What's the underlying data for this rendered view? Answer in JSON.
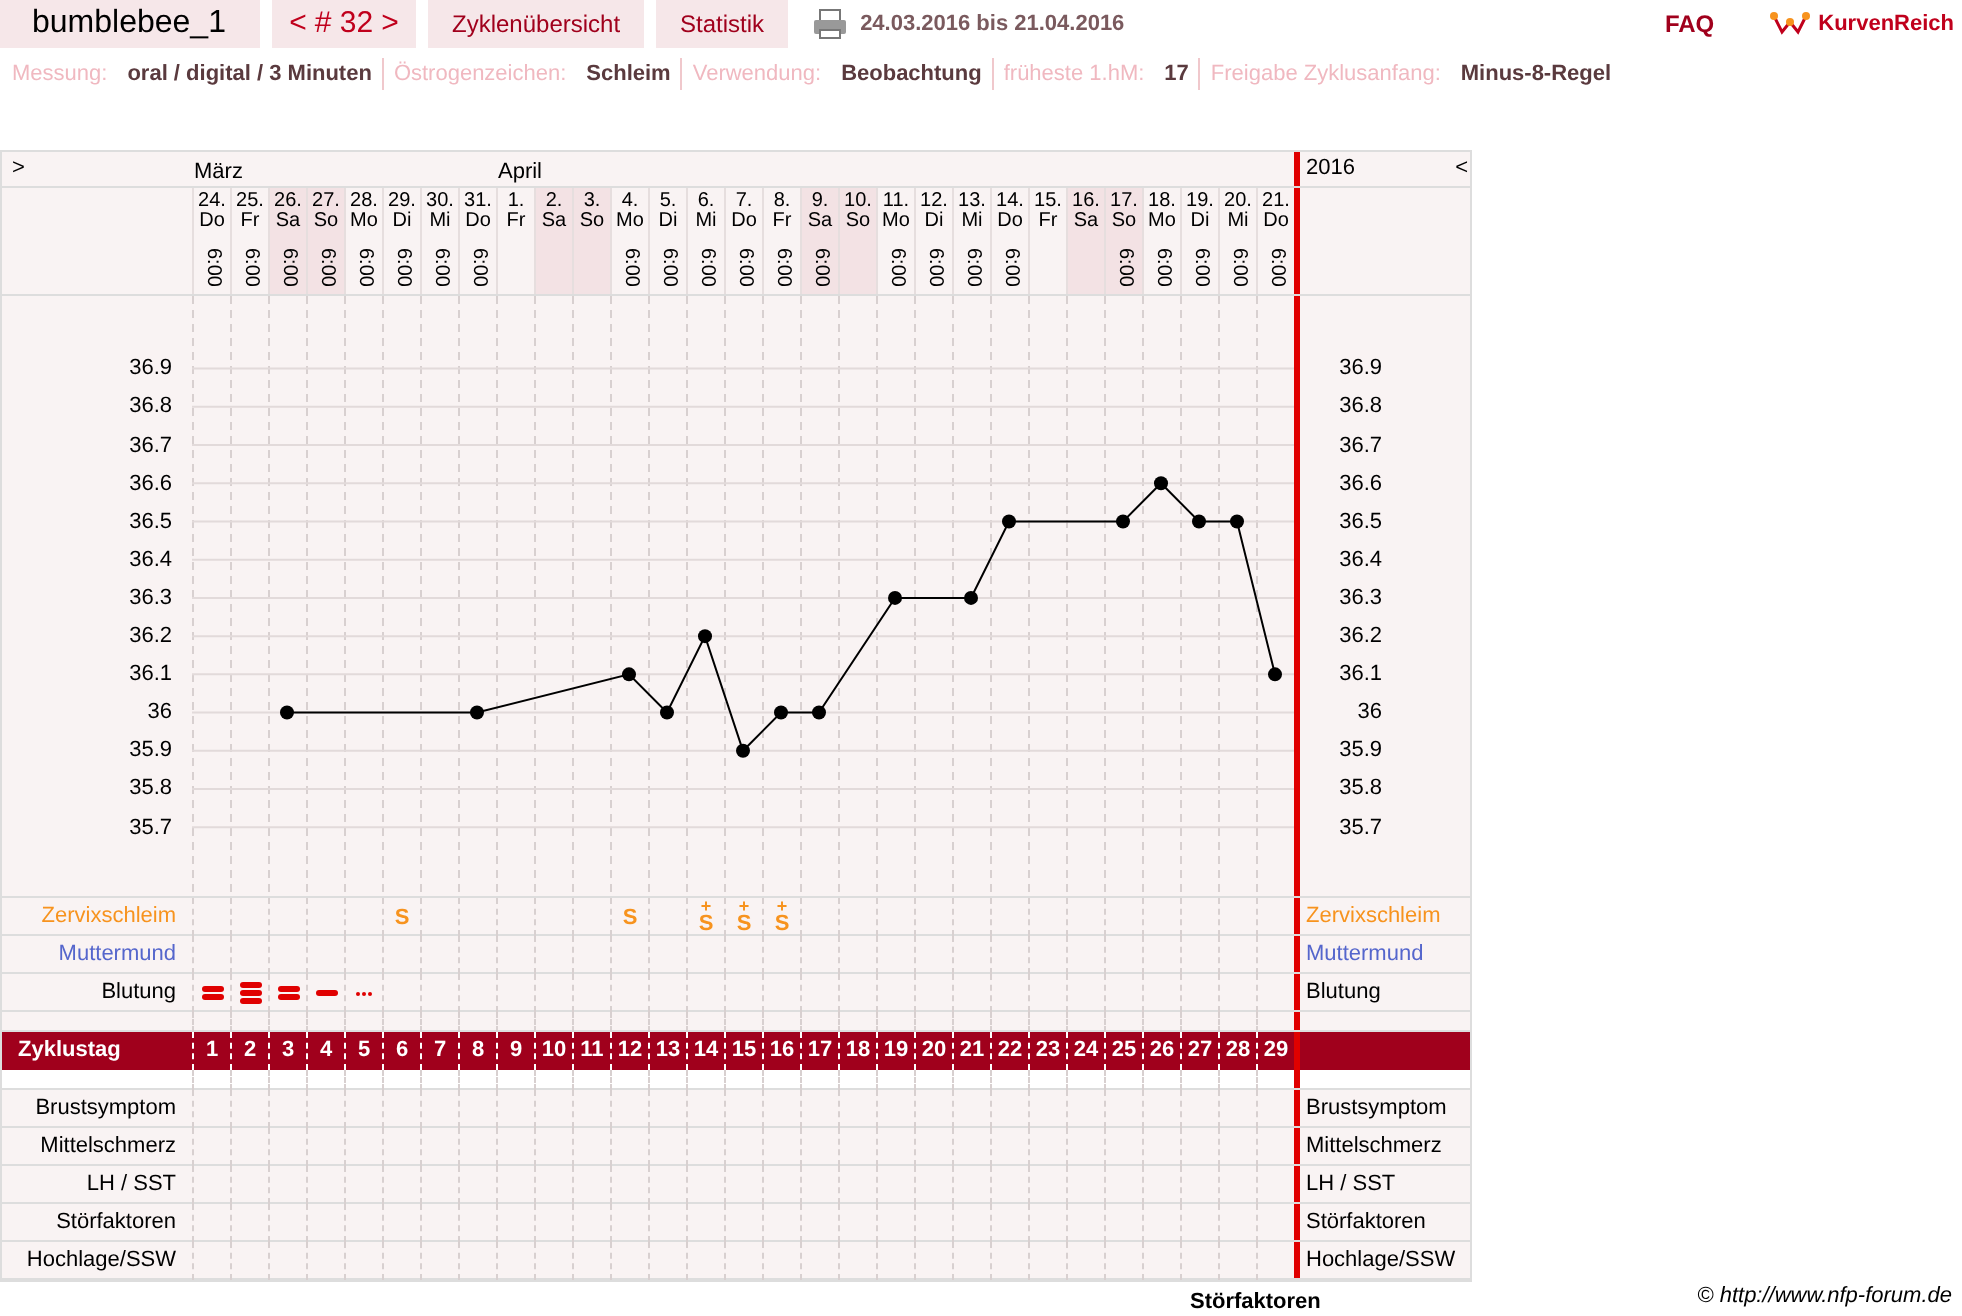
{
  "header": {
    "user": "bumblebee_1",
    "prev": "<",
    "cycle": "# 32",
    "next": ">",
    "tabs": [
      {
        "label": "Zyklenübersicht",
        "selected": false
      },
      {
        "label": "Statistik",
        "selected": false
      }
    ],
    "period": "24.03.2016 bis 21.04.2016",
    "faq": "FAQ",
    "logo": "KurvenReich"
  },
  "info": [
    {
      "label": "Messung:",
      "value": "oral / digital / 3 Minuten"
    },
    {
      "label": "Östrogenzeichen:",
      "value": "Schleim"
    },
    {
      "label": "Verwendung:",
      "value": "Beobachtung"
    },
    {
      "label": "früheste 1.hM:",
      "value": "17"
    },
    {
      "label": "Freigabe Zyklusanfang:",
      "value": "Minus-8-Regel"
    }
  ],
  "chart_header": {
    "left_toggle": ">",
    "year": "2016",
    "right_toggle": "<"
  },
  "days": [
    {
      "month": "März",
      "date": "24.",
      "weekday": "Do",
      "time": "6:00",
      "weekend": false,
      "cycle_day": "1",
      "bleeding": {
        "kind": "medium"
      }
    },
    {
      "date": "25.",
      "weekday": "Fr",
      "time": "6:00",
      "weekend": false,
      "cycle_day": "2",
      "bleeding": {
        "kind": "heavy"
      }
    },
    {
      "date": "26.",
      "weekday": "Sa",
      "time": "6:00",
      "weekend": true,
      "cycle_day": "3",
      "bleeding": {
        "kind": "medium"
      }
    },
    {
      "date": "27.",
      "weekday": "So",
      "time": "6:00",
      "weekend": true,
      "cycle_day": "4",
      "bleeding": {
        "kind": "light"
      }
    },
    {
      "date": "28.",
      "weekday": "Mo",
      "time": "6:00",
      "weekend": false,
      "cycle_day": "5",
      "bleeding": {
        "kind": "spotting"
      }
    },
    {
      "date": "29.",
      "weekday": "Di",
      "time": "6:00",
      "weekend": false,
      "cycle_day": "6",
      "mucus": "S"
    },
    {
      "date": "30.",
      "weekday": "Mi",
      "time": "6:00",
      "weekend": false,
      "cycle_day": "7"
    },
    {
      "date": "31.",
      "weekday": "Do",
      "time": "6:00",
      "weekend": false,
      "cycle_day": "8"
    },
    {
      "month": "April",
      "date": "1.",
      "weekday": "Fr",
      "weekend": false,
      "cycle_day": "9"
    },
    {
      "date": "2.",
      "weekday": "Sa",
      "weekend": true,
      "cycle_day": "10"
    },
    {
      "date": "3.",
      "weekday": "So",
      "weekend": true,
      "cycle_day": "11"
    },
    {
      "date": "4.",
      "weekday": "Mo",
      "time": "6:00",
      "weekend": false,
      "cycle_day": "12",
      "mucus": "S"
    },
    {
      "date": "5.",
      "weekday": "Di",
      "time": "6:00",
      "weekend": false,
      "cycle_day": "13"
    },
    {
      "date": "6.",
      "weekday": "Mi",
      "time": "6:00",
      "weekend": false,
      "cycle_day": "14",
      "mucus": "S",
      "mucus_mark": "+"
    },
    {
      "date": "7.",
      "weekday": "Do",
      "time": "6:00",
      "weekend": false,
      "cycle_day": "15",
      "mucus": "S",
      "mucus_mark": "+"
    },
    {
      "date": "8.",
      "weekday": "Fr",
      "time": "6:00",
      "weekend": false,
      "cycle_day": "16",
      "mucus": "S",
      "mucus_mark": "+"
    },
    {
      "date": "9.",
      "weekday": "Sa",
      "time": "6:00",
      "weekend": true,
      "cycle_day": "17"
    },
    {
      "date": "10.",
      "weekday": "So",
      "weekend": true,
      "cycle_day": "18"
    },
    {
      "date": "11.",
      "weekday": "Mo",
      "time": "6:00",
      "weekend": false,
      "cycle_day": "19"
    },
    {
      "date": "12.",
      "weekday": "Di",
      "time": "6:00",
      "weekend": false,
      "cycle_day": "20"
    },
    {
      "date": "13.",
      "weekday": "Mi",
      "time": "6:00",
      "weekend": false,
      "cycle_day": "21"
    },
    {
      "date": "14.",
      "weekday": "Do",
      "time": "6:00",
      "weekend": false,
      "cycle_day": "22"
    },
    {
      "date": "15.",
      "weekday": "Fr",
      "weekend": false,
      "cycle_day": "23"
    },
    {
      "date": "16.",
      "weekday": "Sa",
      "weekend": true,
      "cycle_day": "24"
    },
    {
      "date": "17.",
      "weekday": "So",
      "time": "6:00",
      "weekend": true,
      "cycle_day": "25"
    },
    {
      "date": "18.",
      "weekday": "Mo",
      "time": "6:00",
      "weekend": false,
      "cycle_day": "26"
    },
    {
      "date": "19.",
      "weekday": "Di",
      "time": "6:00",
      "weekend": false,
      "cycle_day": "27"
    },
    {
      "date": "20.",
      "weekday": "Mi",
      "time": "6:00",
      "weekend": false,
      "cycle_day": "28"
    },
    {
      "date": "21.",
      "weekday": "Do",
      "time": "6:00",
      "weekend": false,
      "cycle_day": "29"
    }
  ],
  "chart_data": {
    "type": "line",
    "grid": true,
    "ylim": [
      35.52,
      37.09
    ],
    "series": [
      {
        "color": "#000000",
        "marker": "circle",
        "values": [
          null,
          null,
          36.0,
          null,
          null,
          null,
          null,
          36.0,
          null,
          null,
          null,
          36.1,
          36.0,
          36.2,
          35.9,
          36.0,
          36.0,
          null,
          36.3,
          null,
          36.3,
          36.5,
          null,
          null,
          36.5,
          36.6,
          36.5,
          36.5,
          36.1
        ]
      }
    ],
    "yticks": [
      {
        "value": 35.7,
        "label": "35.7"
      },
      {
        "value": 35.8,
        "label": "35.8"
      },
      {
        "value": 35.9,
        "label": "35.9"
      },
      {
        "value": 36.0,
        "label": "36"
      },
      {
        "value": 36.1,
        "label": "36.1"
      },
      {
        "value": 36.2,
        "label": "36.2"
      },
      {
        "value": 36.3,
        "label": "36.3"
      },
      {
        "value": 36.4,
        "label": "36.4"
      },
      {
        "value": 36.5,
        "label": "36.5"
      },
      {
        "value": 36.6,
        "label": "36.6"
      },
      {
        "value": 36.7,
        "label": "36.7"
      },
      {
        "value": 36.8,
        "label": "36.8"
      },
      {
        "value": 36.9,
        "label": "36.9"
      }
    ]
  },
  "sign_rows": [
    {
      "kind": "mucus",
      "left_label": "Zervixschleim",
      "right_label": "Zervixschleim",
      "color": "#f7931e"
    },
    {
      "kind": "cervix",
      "left_label": "Muttermund",
      "right_label": "Muttermund",
      "color": "#5566cc"
    },
    {
      "kind": "bleeding",
      "left_label": "Blutung",
      "right_label": "Blutung",
      "color": "#000000"
    }
  ],
  "cycle_day_label": "Zyklustag",
  "extra_rows": [
    {
      "left_label": "Brustsymptom",
      "right_label": "Brustsymptom"
    },
    {
      "left_label": "Mittelschmerz",
      "right_label": "Mittelschmerz"
    },
    {
      "left_label": "LH / SST",
      "right_label": "LH / SST"
    },
    {
      "left_label": "Störfaktoren",
      "right_label": "Störfaktoren"
    },
    {
      "left_label": "Hochlage/SSW",
      "right_label": "Hochlage/SSW"
    }
  ],
  "copyright": "© http://www.nfp-forum.de",
  "footer_heading": "Störfaktoren"
}
